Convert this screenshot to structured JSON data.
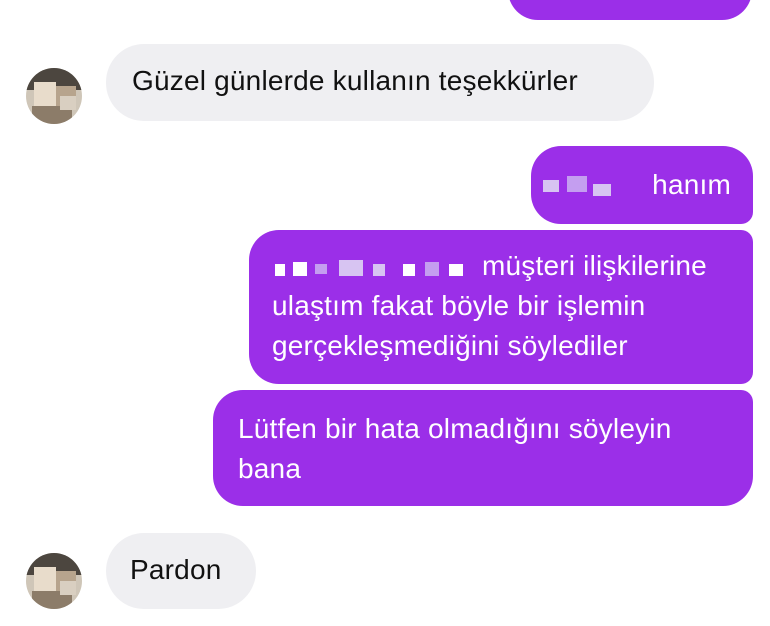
{
  "messages": [
    {
      "side": "incoming",
      "text": "Güzel günlerde kullanın teşekkürler"
    },
    {
      "side": "outgoing",
      "text": "hanım"
    },
    {
      "side": "outgoing",
      "text_lines": [
        "müşteri ilişkilerine",
        "ulaştım fakat böyle bir işlemin",
        "gerçekleşmediğini söylediler"
      ]
    },
    {
      "side": "outgoing",
      "text_lines": [
        "Lütfen bir hata olmadığını söyleyin",
        "bana"
      ]
    },
    {
      "side": "incoming",
      "text": "Pardon"
    }
  ],
  "colors": {
    "outgoing_bubble": "#9b2fe8",
    "incoming_bubble": "#efeff2",
    "incoming_text": "#111111",
    "outgoing_text": "#ffffff"
  }
}
